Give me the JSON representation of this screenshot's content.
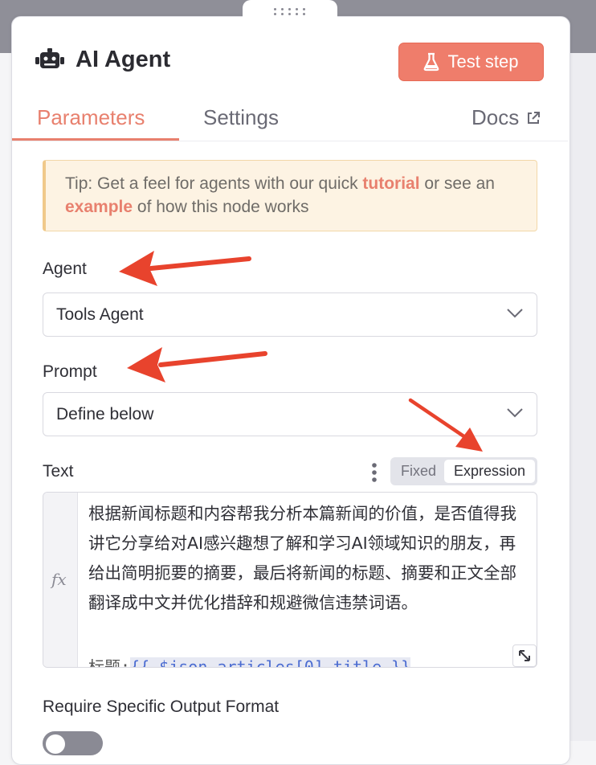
{
  "header": {
    "title": "AI Agent",
    "test_button_label": "Test step"
  },
  "tabs": [
    {
      "label": "Parameters",
      "active": true
    },
    {
      "label": "Settings",
      "active": false
    },
    {
      "label": "Docs",
      "active": false
    }
  ],
  "tip": {
    "prefix": "Tip: Get a feel for agents with our quick ",
    "link1": "tutorial",
    "middle": " or see an ",
    "link2": "example",
    "suffix": " of how this node works"
  },
  "fields": {
    "agent_label": "Agent",
    "agent_value": "Tools Agent",
    "prompt_label": "Prompt",
    "prompt_value": "Define below",
    "text_label": "Text",
    "mode_fixed": "Fixed",
    "mode_expression": "Expression",
    "text_value": "根据新闻标题和内容帮我分析本篇新闻的价值，是否值得我讲它分享给对AI感兴趣想了解和学习AI领域知识的朋友，再给出简明扼要的摘要，最后将新闻的标题、摘要和正文全部翻译成中文并优化措辞和规避微信违禁词语。",
    "text_line2_prefix": "标题:",
    "text_line2_expr": "{{ $json.articles[0].title }}",
    "fx_label": "fx",
    "require_label": "Require Specific Output Format"
  },
  "colors": {
    "accent": "#e8806e",
    "button": "#ef7d6b",
    "tip_bg": "#fdf3e3",
    "arrow": "#e8432d"
  }
}
